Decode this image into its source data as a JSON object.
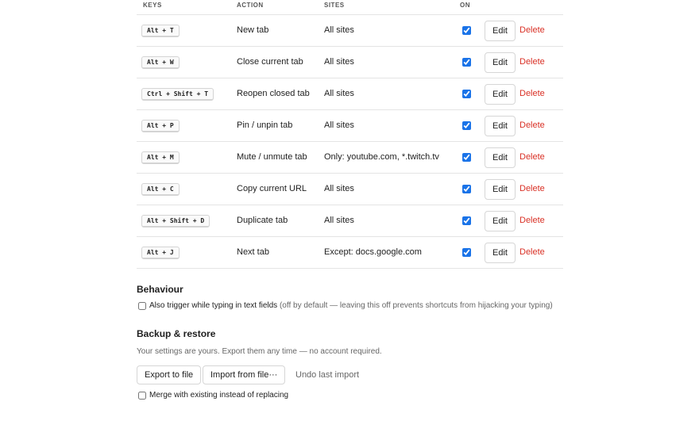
{
  "table": {
    "headers": {
      "keys": "KEYS",
      "action": "ACTION",
      "sites": "SITES",
      "on": "ON"
    },
    "rows": [
      {
        "keys": "Alt + T",
        "action": "New tab",
        "sites": "All sites",
        "on": true
      },
      {
        "keys": "Alt + W",
        "action": "Close current tab",
        "sites": "All sites",
        "on": true
      },
      {
        "keys": "Ctrl + Shift + T",
        "action": "Reopen closed tab",
        "sites": "All sites",
        "on": true
      },
      {
        "keys": "Alt + P",
        "action": "Pin / unpin tab",
        "sites": "All sites",
        "on": true
      },
      {
        "keys": "Alt + M",
        "action": "Mute / unmute tab",
        "sites": "Only: youtube.com, *.twitch.tv",
        "on": true
      },
      {
        "keys": "Alt + C",
        "action": "Copy current URL",
        "sites": "All sites",
        "on": true
      },
      {
        "keys": "Alt + Shift + D",
        "action": "Duplicate tab",
        "sites": "All sites",
        "on": true
      },
      {
        "keys": "Alt + J",
        "action": "Next tab",
        "sites": "Except: docs.google.com",
        "on": true
      }
    ],
    "edit_label": "Edit",
    "delete_label": "Delete",
    "accent": "#1a73e8",
    "delete_color": "#d93025"
  },
  "behaviour": {
    "title": "Behaviour",
    "option_label": "Also trigger while typing in text fields",
    "option_note": "(off by default — leaving this off prevents shortcuts from hijacking your typing)",
    "option_checked": false
  },
  "backup": {
    "title": "Backup & restore",
    "description": "Your settings are yours. Export them any time — no account required.",
    "export_label": "Export to file",
    "import_label": "Import from file···",
    "undo_label": "Undo last import",
    "merge_label": "Merge with existing instead of replacing",
    "merge_checked": false
  }
}
